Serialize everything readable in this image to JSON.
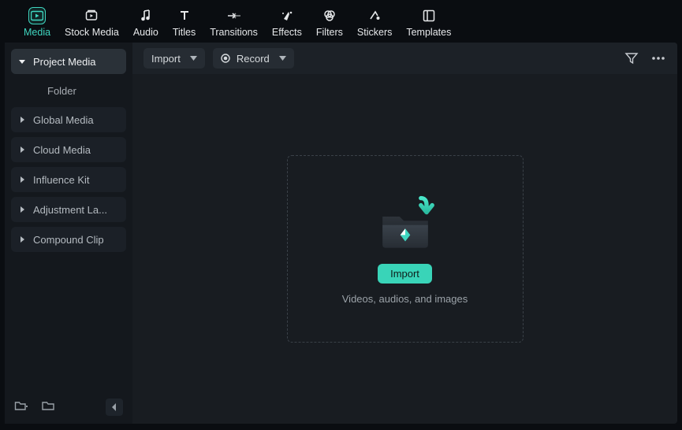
{
  "top_tabs": [
    {
      "label": "Media",
      "icon": "media-icon",
      "active": true
    },
    {
      "label": "Stock Media",
      "icon": "stock-media-icon",
      "active": false
    },
    {
      "label": "Audio",
      "icon": "audio-icon",
      "active": false
    },
    {
      "label": "Titles",
      "icon": "titles-icon",
      "active": false
    },
    {
      "label": "Transitions",
      "icon": "transitions-icon",
      "active": false
    },
    {
      "label": "Effects",
      "icon": "effects-icon",
      "active": false
    },
    {
      "label": "Filters",
      "icon": "filters-icon",
      "active": false
    },
    {
      "label": "Stickers",
      "icon": "stickers-icon",
      "active": false
    },
    {
      "label": "Templates",
      "icon": "templates-icon",
      "active": false
    }
  ],
  "sidebar": {
    "items": [
      {
        "label": "Project Media",
        "expanded": true,
        "selected": true
      },
      {
        "label": "Folder",
        "sub": true
      },
      {
        "label": "Global Media"
      },
      {
        "label": "Cloud Media"
      },
      {
        "label": "Influence Kit"
      },
      {
        "label": "Adjustment La..."
      },
      {
        "label": "Compound Clip"
      }
    ]
  },
  "toolbar": {
    "import_label": "Import",
    "record_label": "Record"
  },
  "dropzone": {
    "import_button": "Import",
    "hint": "Videos, audios, and images"
  },
  "colors": {
    "accent": "#3fd6c0"
  }
}
